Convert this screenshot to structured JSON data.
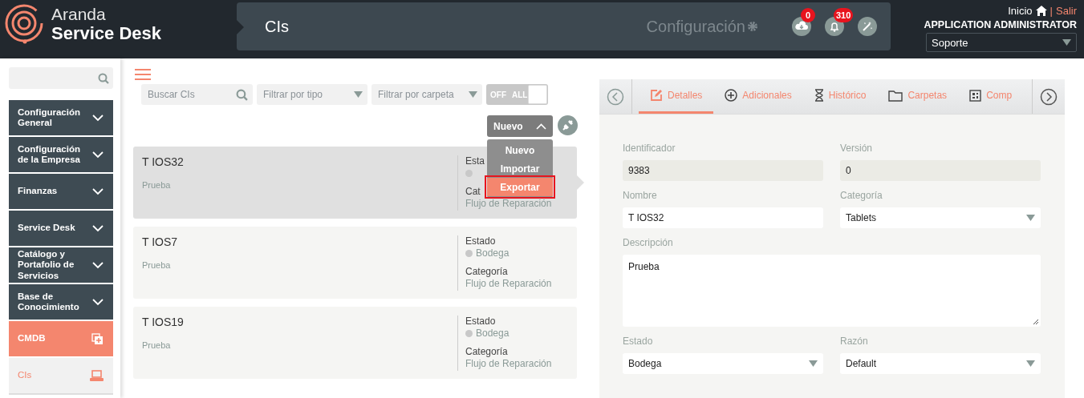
{
  "header": {
    "brand_top": "Aranda",
    "brand_bottom": "Service Desk",
    "page_title": "CIs",
    "section": "Configuración",
    "actions": [
      {
        "kind": "download",
        "count": "0"
      },
      {
        "kind": "bell",
        "count": "310"
      },
      {
        "kind": "wand"
      }
    ],
    "home_link": "Inicio",
    "separator": "|",
    "logout_link": "Salir",
    "user": "APPLICATION ADMINISTRATOR",
    "project": "Soporte"
  },
  "sidebar": {
    "items": [
      {
        "label": "Configuración General",
        "kind": "group",
        "selected": false
      },
      {
        "label": "Configuración de la Empresa",
        "kind": "group",
        "selected": false
      },
      {
        "label": "Finanzas",
        "kind": "group",
        "selected": false
      },
      {
        "label": "Service Desk",
        "kind": "group",
        "selected": false
      },
      {
        "label": "Catálogo y Portafolio de Servicios",
        "kind": "group",
        "selected": false
      },
      {
        "label": "Base de Conocimiento",
        "kind": "group",
        "selected": false
      },
      {
        "label": "CMDB",
        "kind": "module",
        "selected": true
      },
      {
        "label": "CIs",
        "kind": "page",
        "selected": true
      }
    ]
  },
  "toolbar": {
    "search_placeholder": "Buscar CIs",
    "type_filter_placeholder": "Filtrar por tipo",
    "folder_filter_placeholder": "Filtrar por carpeta",
    "toggle": {
      "off_label": "OFF",
      "on_label": "ALL",
      "on": false
    },
    "new_button": "Nuevo",
    "expanded": true,
    "menu": [
      {
        "label": "Nuevo",
        "selected": false,
        "highlighted": false
      },
      {
        "label": "Importar",
        "selected": false,
        "highlighted": false
      },
      {
        "label": "Exportar",
        "selected": true,
        "highlighted": true
      }
    ]
  },
  "cards": [
    {
      "name": "T IOS32",
      "description": "Prueba",
      "status_label": "Esta",
      "category_label": "Cat",
      "category_value": "Flujo de Reparación",
      "selected": true
    },
    {
      "name": "T IOS7",
      "description": "Prueba",
      "status_label": "Estado",
      "status_value": "Bodega",
      "category_label": "Categoría",
      "category_value": "Flujo de Reparación",
      "selected": false
    },
    {
      "name": "T IOS19",
      "description": "Prueba",
      "status_label": "Estado",
      "status_value": "Bodega",
      "category_label": "Categoría",
      "category_value": "Flujo de Reparación",
      "selected": false
    }
  ],
  "detail": {
    "tabs": [
      {
        "label": "Detalles",
        "kind": "edit",
        "selected": true
      },
      {
        "label": "Adicionales",
        "kind": "plus",
        "selected": false
      },
      {
        "label": "Histórico",
        "kind": "hourglass",
        "selected": false
      },
      {
        "label": "Carpetas",
        "kind": "folder",
        "selected": false
      },
      {
        "label": "Comp",
        "kind": "grid",
        "selected": false
      }
    ],
    "fields": [
      {
        "label": "Identificador",
        "value": "9383",
        "kind": "readonly"
      },
      {
        "label": "Versión",
        "value": "0",
        "kind": "readonly"
      },
      {
        "label": "Nombre",
        "value": "T IOS32",
        "kind": "text"
      },
      {
        "label": "Categoría",
        "value": "Tablets",
        "kind": "select"
      },
      {
        "label": "Descripción",
        "value": "Prueba",
        "kind": "textarea"
      },
      {
        "label": "Estado",
        "value": "Bodega",
        "kind": "select"
      },
      {
        "label": "Razón",
        "value": "Default",
        "kind": "select"
      }
    ]
  }
}
